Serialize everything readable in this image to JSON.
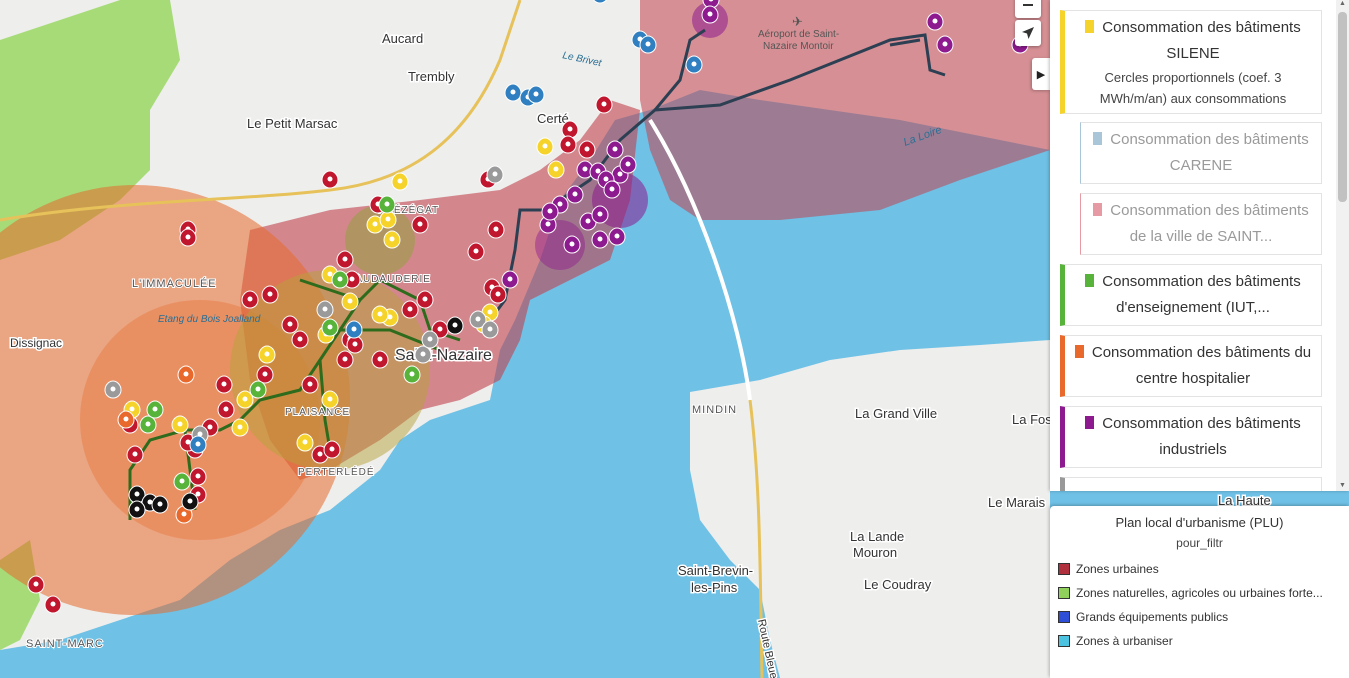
{
  "map": {
    "places": [
      {
        "label": "Aucard",
        "cls": "place",
        "size": 13
      },
      {
        "label": "Trembly",
        "cls": "place",
        "size": 13
      },
      {
        "label": "Le Petit Marsac",
        "cls": "place",
        "size": 13
      },
      {
        "label": "Certé",
        "cls": "place",
        "size": 13
      },
      {
        "label": "Saint-Nazaire",
        "cls": "place",
        "size": 16
      },
      {
        "label": "L'IMMACULÉE",
        "cls": "quarter",
        "size": 11
      },
      {
        "label": "Dissignac",
        "cls": "place",
        "size": 12
      },
      {
        "label": "Etang du Bois Joalland",
        "cls": "water",
        "size": 10
      },
      {
        "label": "PRÉZÉGAT",
        "cls": "quarter",
        "size": 10
      },
      {
        "label": "BEAUDAUDERIE",
        "cls": "quarter",
        "size": 10
      },
      {
        "label": "PLAISANCE",
        "cls": "quarter",
        "size": 10
      },
      {
        "label": "PERTERLÉDÉ",
        "cls": "quarter",
        "size": 10
      },
      {
        "label": "MINDIN",
        "cls": "quarter",
        "size": 11
      },
      {
        "label": "La Grand Ville",
        "cls": "place",
        "size": 13
      },
      {
        "label": "La Fos",
        "cls": "place",
        "size": 13
      },
      {
        "label": "Le Marais",
        "cls": "place",
        "size": 13
      },
      {
        "label": "La Haute",
        "cls": "place",
        "size": 13
      },
      {
        "label": "La Lande",
        "cls": "place",
        "size": 13
      },
      {
        "label": "Mouron",
        "cls": "place",
        "size": 13
      },
      {
        "label": "Le Coudray",
        "cls": "place",
        "size": 13
      },
      {
        "label": "Saint-Brevin-",
        "cls": "place",
        "size": 13
      },
      {
        "label": "les-Pins",
        "cls": "place",
        "size": 13
      },
      {
        "label": "SAINT-MARC",
        "cls": "quarter",
        "size": 11
      },
      {
        "label": "La Loire",
        "cls": "water",
        "size": 11
      },
      {
        "label": "Le Brivet",
        "cls": "water",
        "size": 10
      },
      {
        "label": "Route Bleue",
        "cls": "place",
        "size": 11
      },
      {
        "label": "Aéroport de Saint-",
        "cls": "airport",
        "size": 10
      },
      {
        "label": "Nazaire Montoir",
        "cls": "airport",
        "size": 10
      }
    ],
    "colors": {
      "sea": "#6fc1e6",
      "land": "#eeeeec",
      "urban": "#c2434f",
      "natural": "#8fd15a",
      "silene": "#f5d32a",
      "carene": "#9a9a9a",
      "ville": "#c0172f",
      "enseignement": "#57b33a",
      "hospitalier": "#e8692b",
      "industriels": "#8d1a8e",
      "other_blue": "#2f7fc1",
      "other_black": "#111111",
      "network": "#2d3f52",
      "network_green": "#2e6b1c"
    }
  },
  "controls": {
    "zoom_icon": "square-icon",
    "locate_icon": "navigation-arrow-icon",
    "toggle_icon": "caret-right-icon",
    "toggle_glyph": "▶"
  },
  "panel": {
    "layers": [
      {
        "id": "silene",
        "title": "Consommation des bâtiments SILENE",
        "desc": "Cercles proportionnels (coef. 3 MWh/m/an) aux consommations",
        "color": "#f5d32a",
        "active": true
      },
      {
        "id": "carene",
        "title": "Consommation des bâtiments CARENE",
        "desc": "",
        "color": "#a9c6d8",
        "active": false
      },
      {
        "id": "ville",
        "title": "Consommation des bâtiments de la ville de SAINT...",
        "desc": "",
        "color": "#e59aa4",
        "active": false
      },
      {
        "id": "enseignement",
        "title": "Consommation des bâtiments d'enseignement (IUT,...",
        "desc": "",
        "color": "#57b33a",
        "active": true
      },
      {
        "id": "hospitalier",
        "title": "Consommation des bâtiments du centre hospitalier",
        "desc": "",
        "color": "#e8692b",
        "active": true
      },
      {
        "id": "industriels",
        "title": "Consommation des bâtiments industriels",
        "desc": "",
        "color": "#8d1a8e",
        "active": true
      }
    ]
  },
  "legend": {
    "title": "Plan local d'urbanisme (PLU)",
    "subtitle": "pour_filtr",
    "items": [
      {
        "label": "Zones urbaines",
        "color": "#b0303e"
      },
      {
        "label": "Zones naturelles, agricoles ou urbaines forte...",
        "color": "#8fd15a"
      },
      {
        "label": "Grands équipements publics",
        "color": "#2f4ed6"
      },
      {
        "label": "Zones à urbaniser",
        "color": "#4cc3e0"
      }
    ]
  }
}
